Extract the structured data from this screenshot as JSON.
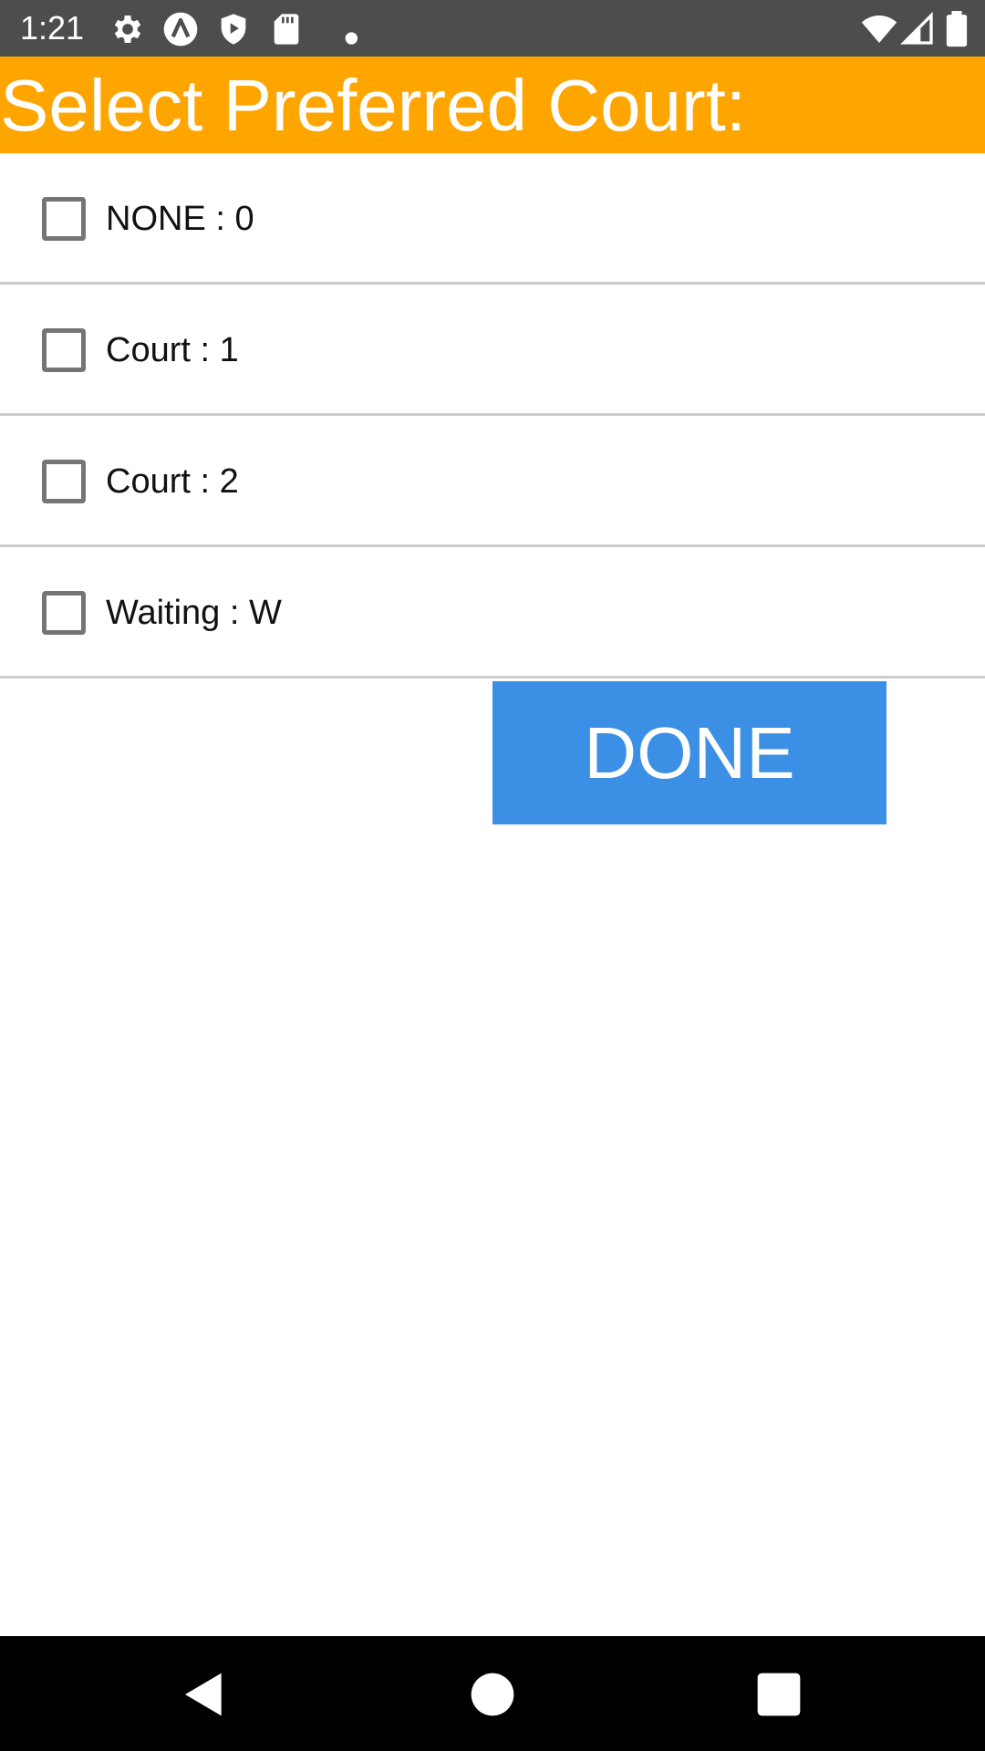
{
  "status_bar": {
    "time": "1:21",
    "left_icons": [
      "gear-icon",
      "app-icon",
      "shield-icon",
      "sd-card-icon",
      "dot-icon"
    ],
    "right_icons": [
      "wifi-icon",
      "signal-icon",
      "battery-icon"
    ]
  },
  "header": {
    "title": "Select Preferred Court:",
    "background": "#ffa500"
  },
  "courts": [
    {
      "label": "NONE : 0",
      "checked": false
    },
    {
      "label": "Court : 1",
      "checked": false
    },
    {
      "label": "Court : 2",
      "checked": false
    },
    {
      "label": "Waiting : W",
      "checked": false
    }
  ],
  "done_button": {
    "label": "DONE",
    "background": "#3b8fe5"
  },
  "nav_bar": {
    "icons": [
      "back-icon",
      "home-icon",
      "recents-icon"
    ]
  }
}
